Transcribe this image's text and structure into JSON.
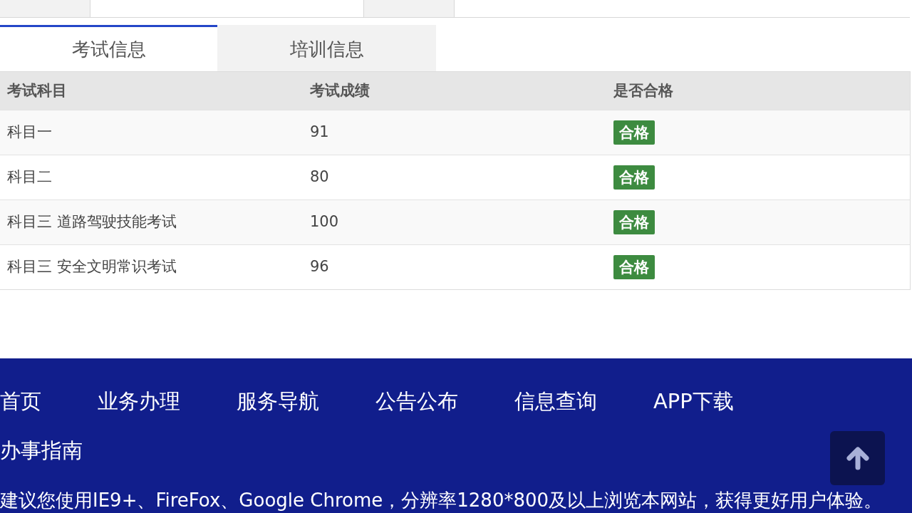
{
  "tabs": [
    {
      "label": "考试信息",
      "selected": true
    },
    {
      "label": "培训信息",
      "selected": false
    }
  ],
  "table": {
    "columns": [
      "考试科目",
      "考试成绩",
      "是否合格"
    ],
    "rows": [
      {
        "subject": "科目一",
        "score": "91",
        "result": "合格"
      },
      {
        "subject": "科目二",
        "score": "80",
        "result": "合格"
      },
      {
        "subject": "科目三 道路驾驶技能考试",
        "score": "100",
        "result": "合格"
      },
      {
        "subject": "科目三 安全文明常识考试",
        "score": "96",
        "result": "合格"
      }
    ]
  },
  "footer": {
    "nav": [
      "首页",
      "业务办理",
      "服务导航",
      "公告公布",
      "信息查询",
      "APP下载",
      "办事指南"
    ],
    "note": "建议您使用IE9+、FireFox、Google Chrome，分辨率1280*800及以上浏览本网站，获得更好用户体验。"
  }
}
